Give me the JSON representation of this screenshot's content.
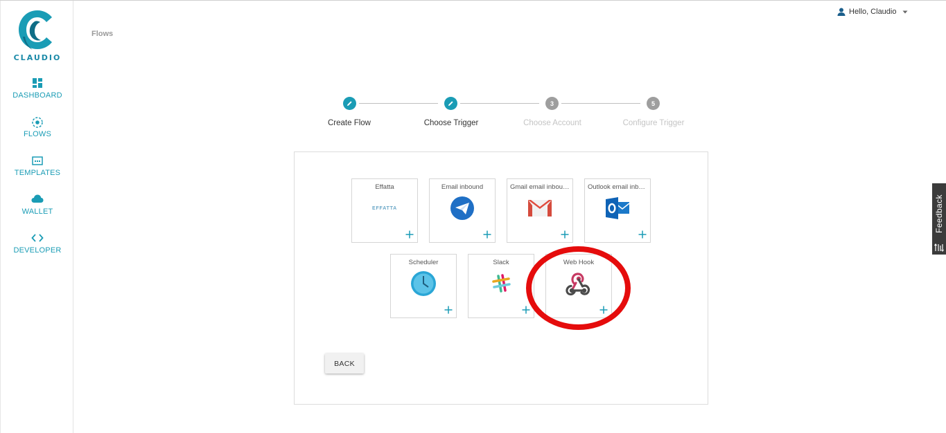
{
  "app": {
    "logo_text": "CLAUDIO",
    "brand_color": "#1a9cb5"
  },
  "header": {
    "breadcrumb": "Flows",
    "user_greeting": "Hello, Claudio"
  },
  "sidebar": {
    "items": [
      {
        "label": "DASHBOARD",
        "icon": "dashboard-icon"
      },
      {
        "label": "FLOWS",
        "icon": "flows-icon"
      },
      {
        "label": "TEMPLATES",
        "icon": "templates-icon"
      },
      {
        "label": "WALLET",
        "icon": "cloud-icon"
      },
      {
        "label": "DEVELOPER",
        "icon": "code-icon"
      }
    ]
  },
  "stepper": {
    "steps": [
      {
        "label": "Create Flow",
        "marker": "",
        "state": "done"
      },
      {
        "label": "Choose Trigger",
        "marker": "",
        "state": "done"
      },
      {
        "label": "Choose Account",
        "marker": "3",
        "state": "todo"
      },
      {
        "label": "Configure Trigger",
        "marker": "5",
        "state": "todo"
      }
    ]
  },
  "triggers": [
    {
      "title": "Effatta",
      "logo_text": "EFFATTA",
      "icon": "effatta-logo-icon"
    },
    {
      "title": "Email inbound",
      "icon": "email-inbound-icon"
    },
    {
      "title": "Gmail email inbound",
      "icon": "gmail-icon"
    },
    {
      "title": "Outlook email inbound",
      "icon": "outlook-icon"
    },
    {
      "title": "Scheduler",
      "icon": "clock-icon"
    },
    {
      "title": "Slack",
      "icon": "slack-icon"
    },
    {
      "title": "Web Hook",
      "icon": "webhook-icon"
    }
  ],
  "actions": {
    "back_label": "BACK"
  },
  "feedback": {
    "label": "Feedback"
  }
}
